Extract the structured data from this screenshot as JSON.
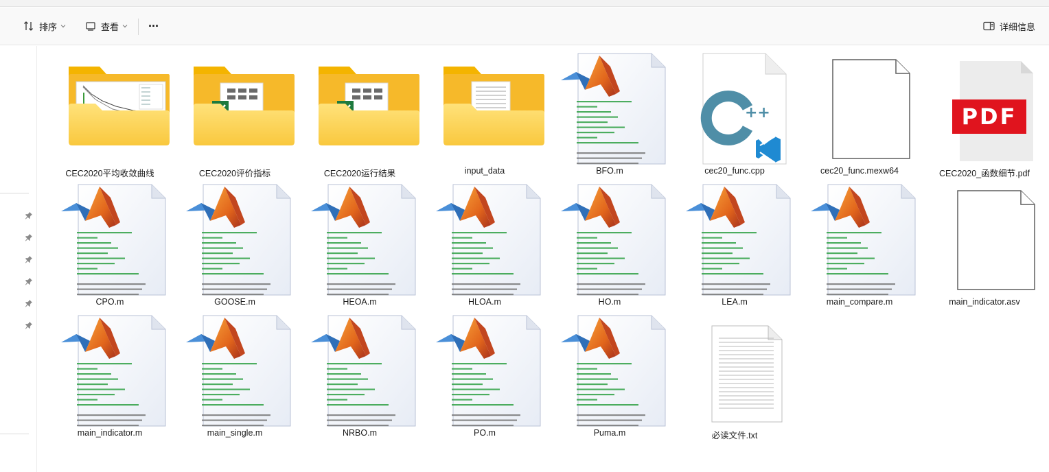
{
  "toolbar": {
    "sort_label": "排序",
    "view_label": "查看",
    "more_label": "···",
    "details_label": "详细信息"
  },
  "files": [
    {
      "name": "CEC2020平均收敛曲线",
      "kind": "folder-chart"
    },
    {
      "name": "CEC2020评价指标",
      "kind": "folder-excel"
    },
    {
      "name": "CEC2020运行结果",
      "kind": "folder-excel"
    },
    {
      "name": "input_data",
      "kind": "folder-doc"
    },
    {
      "name": "BFO.m",
      "kind": "matlab"
    },
    {
      "name": "cec20_func.cpp",
      "kind": "cpp"
    },
    {
      "name": "cec20_func.mexw64",
      "kind": "blank"
    },
    {
      "name": "CEC2020_函数细节.pdf",
      "kind": "pdf"
    },
    {
      "name": "CPO.m",
      "kind": "matlab"
    },
    {
      "name": "GOOSE.m",
      "kind": "matlab"
    },
    {
      "name": "HEOA.m",
      "kind": "matlab"
    },
    {
      "name": "HLOA.m",
      "kind": "matlab"
    },
    {
      "name": "HO.m",
      "kind": "matlab"
    },
    {
      "name": "LEA.m",
      "kind": "matlab"
    },
    {
      "name": "main_compare.m",
      "kind": "matlab"
    },
    {
      "name": "main_indicator.asv",
      "kind": "blank"
    },
    {
      "name": "main_indicator.m",
      "kind": "matlab"
    },
    {
      "name": "main_single.m",
      "kind": "matlab"
    },
    {
      "name": "NRBO.m",
      "kind": "matlab"
    },
    {
      "name": "PO.m",
      "kind": "matlab"
    },
    {
      "name": "Puma.m",
      "kind": "matlab"
    },
    {
      "name": "必读文件.txt",
      "kind": "txt"
    }
  ],
  "pdf_badge": "PDF",
  "cpp_badge": "C++",
  "colors": {
    "folder_back": "#f4b400",
    "folder_front": "#ffd45a",
    "excel_green": "#1d7a3e",
    "pdf_red": "#e0141e",
    "cpp_blue": "#4f8ea7",
    "vscode_blue": "#1f8ad2",
    "matlab_orange": "#e2661c"
  }
}
